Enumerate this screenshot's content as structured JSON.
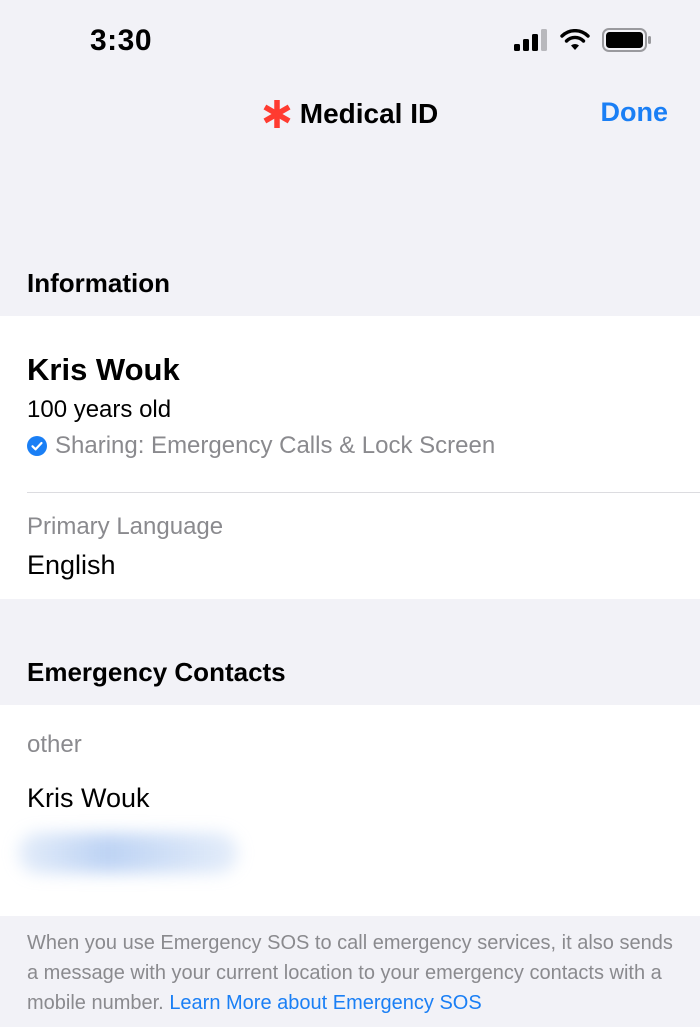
{
  "status_bar": {
    "time": "3:30",
    "icons": [
      "cellular-signal-icon",
      "wifi-icon",
      "battery-icon"
    ]
  },
  "nav": {
    "title": "Medical ID",
    "title_icon": "asterisk-icon",
    "title_icon_color": "#ff3b30",
    "done_label": "Done",
    "accent_color": "#1a7ff5"
  },
  "information": {
    "header": "Information",
    "name": "Kris Wouk",
    "age": "100 years old",
    "sharing": "Sharing: Emergency Calls & Lock Screen",
    "primary_language_label": "Primary Language",
    "primary_language": "English"
  },
  "emergency_contacts": {
    "header": "Emergency Contacts",
    "contacts": [
      {
        "relationship": "other",
        "name": "Kris Wouk"
      }
    ]
  },
  "footer": {
    "text": "When you use Emergency SOS to call emergency services, it also sends a message with your current location to your emergency contacts with a mobile number.",
    "link": "Learn More about Emergency SOS"
  }
}
